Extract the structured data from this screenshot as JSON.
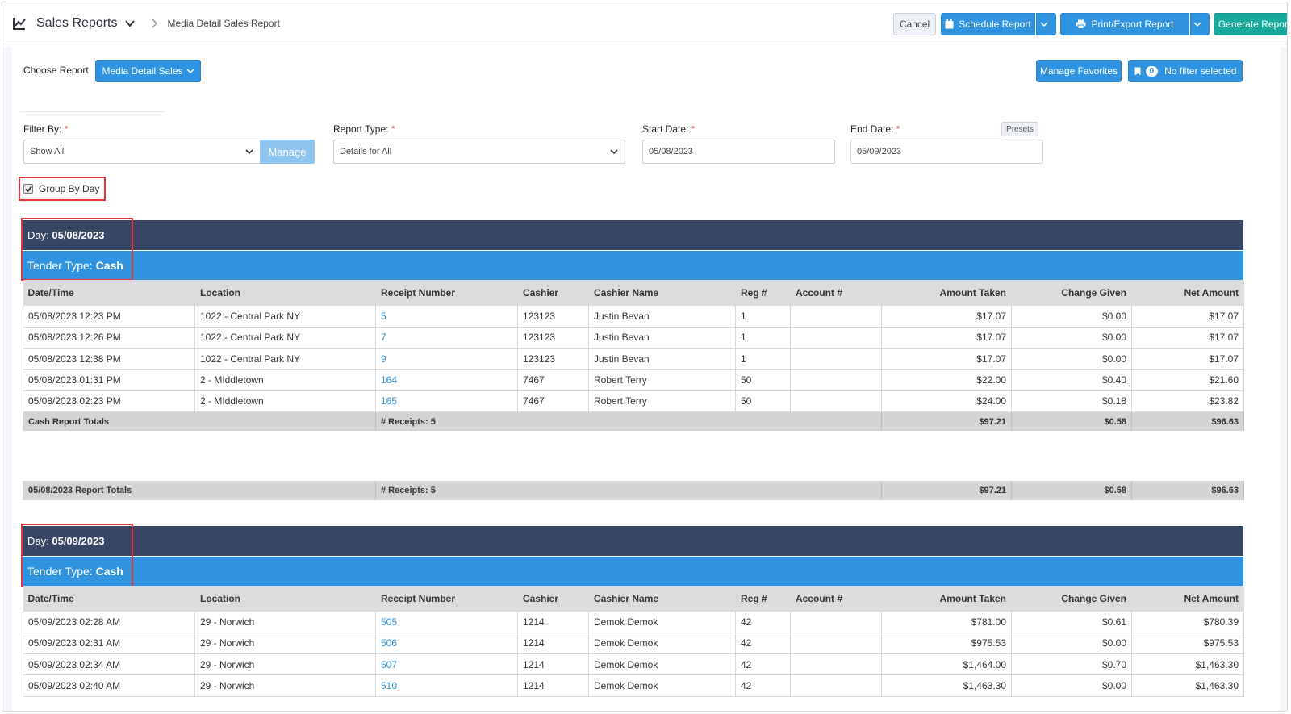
{
  "header": {
    "app_title": "Sales Reports",
    "breadcrumb": "Media Detail Sales Report",
    "buttons": {
      "cancel": "Cancel",
      "schedule": "Schedule Report",
      "print_export": "Print/Export Report",
      "generate": "Generate Report"
    }
  },
  "toolbar": {
    "choose_report_label": "Choose Report",
    "choose_report_value": "Media Detail Sales",
    "manage_favorites": "Manage Favorites",
    "filter_count": "0",
    "filter_status": "No filter selected"
  },
  "filters": {
    "filter_by_label": "Filter By:",
    "filter_by_value": "Show All",
    "manage_button": "Manage",
    "report_type_label": "Report Type:",
    "report_type_value": "Details for All",
    "start_date_label": "Start Date:",
    "start_date_value": "05/08/2023",
    "end_date_label": "End Date:",
    "end_date_value": "05/09/2023",
    "presets_button": "Presets",
    "required_mark": "*",
    "group_by_day_label": "Group By Day",
    "group_by_day_checked": true
  },
  "columns": [
    "Date/Time",
    "Location",
    "Receipt Number",
    "Cashier",
    "Cashier Name",
    "Reg #",
    "Account #",
    "Amount Taken",
    "Change Given",
    "Net Amount"
  ],
  "days": [
    {
      "day_prefix": "Day:",
      "day": "05/08/2023",
      "tender_prefix": "Tender Type:",
      "tender": "Cash",
      "rows": [
        {
          "datetime": "05/08/2023 12:23 PM",
          "location": "1022 - Central Park NY",
          "receipt": "5",
          "cashier": "123123",
          "cashier_name": "Justin Bevan",
          "reg": "1",
          "account": "",
          "amount": "$17.07",
          "change": "$0.00",
          "net": "$17.07"
        },
        {
          "datetime": "05/08/2023 12:26 PM",
          "location": "1022 - Central Park NY",
          "receipt": "7",
          "cashier": "123123",
          "cashier_name": "Justin Bevan",
          "reg": "1",
          "account": "",
          "amount": "$17.07",
          "change": "$0.00",
          "net": "$17.07"
        },
        {
          "datetime": "05/08/2023 12:38 PM",
          "location": "1022 - Central Park NY",
          "receipt": "9",
          "cashier": "123123",
          "cashier_name": "Justin Bevan",
          "reg": "1",
          "account": "",
          "amount": "$17.07",
          "change": "$0.00",
          "net": "$17.07"
        },
        {
          "datetime": "05/08/2023 01:31 PM",
          "location": "2 - MIddletown",
          "receipt": "164",
          "cashier": "7467",
          "cashier_name": "Robert Terry",
          "reg": "50",
          "account": "",
          "amount": "$22.00",
          "change": "$0.40",
          "net": "$21.60"
        },
        {
          "datetime": "05/08/2023 02:23 PM",
          "location": "2 - MIddletown",
          "receipt": "165",
          "cashier": "7467",
          "cashier_name": "Robert Terry",
          "reg": "50",
          "account": "",
          "amount": "$24.00",
          "change": "$0.18",
          "net": "$23.82"
        }
      ],
      "tender_totals": {
        "label": "Cash Report Totals",
        "receipts": "# Receipts: 5",
        "amount": "$97.21",
        "change": "$0.58",
        "net": "$96.63"
      },
      "day_totals": {
        "label": "05/08/2023 Report Totals",
        "receipts": "# Receipts: 5",
        "amount": "$97.21",
        "change": "$0.58",
        "net": "$96.63"
      }
    },
    {
      "day_prefix": "Day:",
      "day": "05/09/2023",
      "tender_prefix": "Tender Type:",
      "tender": "Cash",
      "rows": [
        {
          "datetime": "05/09/2023 02:28 AM",
          "location": "29 - Norwich",
          "receipt": "505",
          "cashier": "1214",
          "cashier_name": "Demok Demok",
          "reg": "42",
          "account": "",
          "amount": "$781.00",
          "change": "$0.61",
          "net": "$780.39"
        },
        {
          "datetime": "05/09/2023 02:31 AM",
          "location": "29 - Norwich",
          "receipt": "506",
          "cashier": "1214",
          "cashier_name": "Demok Demok",
          "reg": "42",
          "account": "",
          "amount": "$975.53",
          "change": "$0.00",
          "net": "$975.53"
        },
        {
          "datetime": "05/09/2023 02:34 AM",
          "location": "29 - Norwich",
          "receipt": "507",
          "cashier": "1214",
          "cashier_name": "Demok Demok",
          "reg": "42",
          "account": "",
          "amount": "$1,464.00",
          "change": "$0.70",
          "net": "$1,463.30"
        },
        {
          "datetime": "05/09/2023 02:40 AM",
          "location": "29 - Norwich",
          "receipt": "510",
          "cashier": "1214",
          "cashier_name": "Demok Demok",
          "reg": "42",
          "account": "",
          "amount": "$1,463.30",
          "change": "$0.00",
          "net": "$1,463.30"
        }
      ]
    }
  ],
  "colors": {
    "day_bar": "#374664",
    "tender_bar": "#2f93e0",
    "generate_button": "#17a99d",
    "highlight_box": "#e0353b"
  }
}
